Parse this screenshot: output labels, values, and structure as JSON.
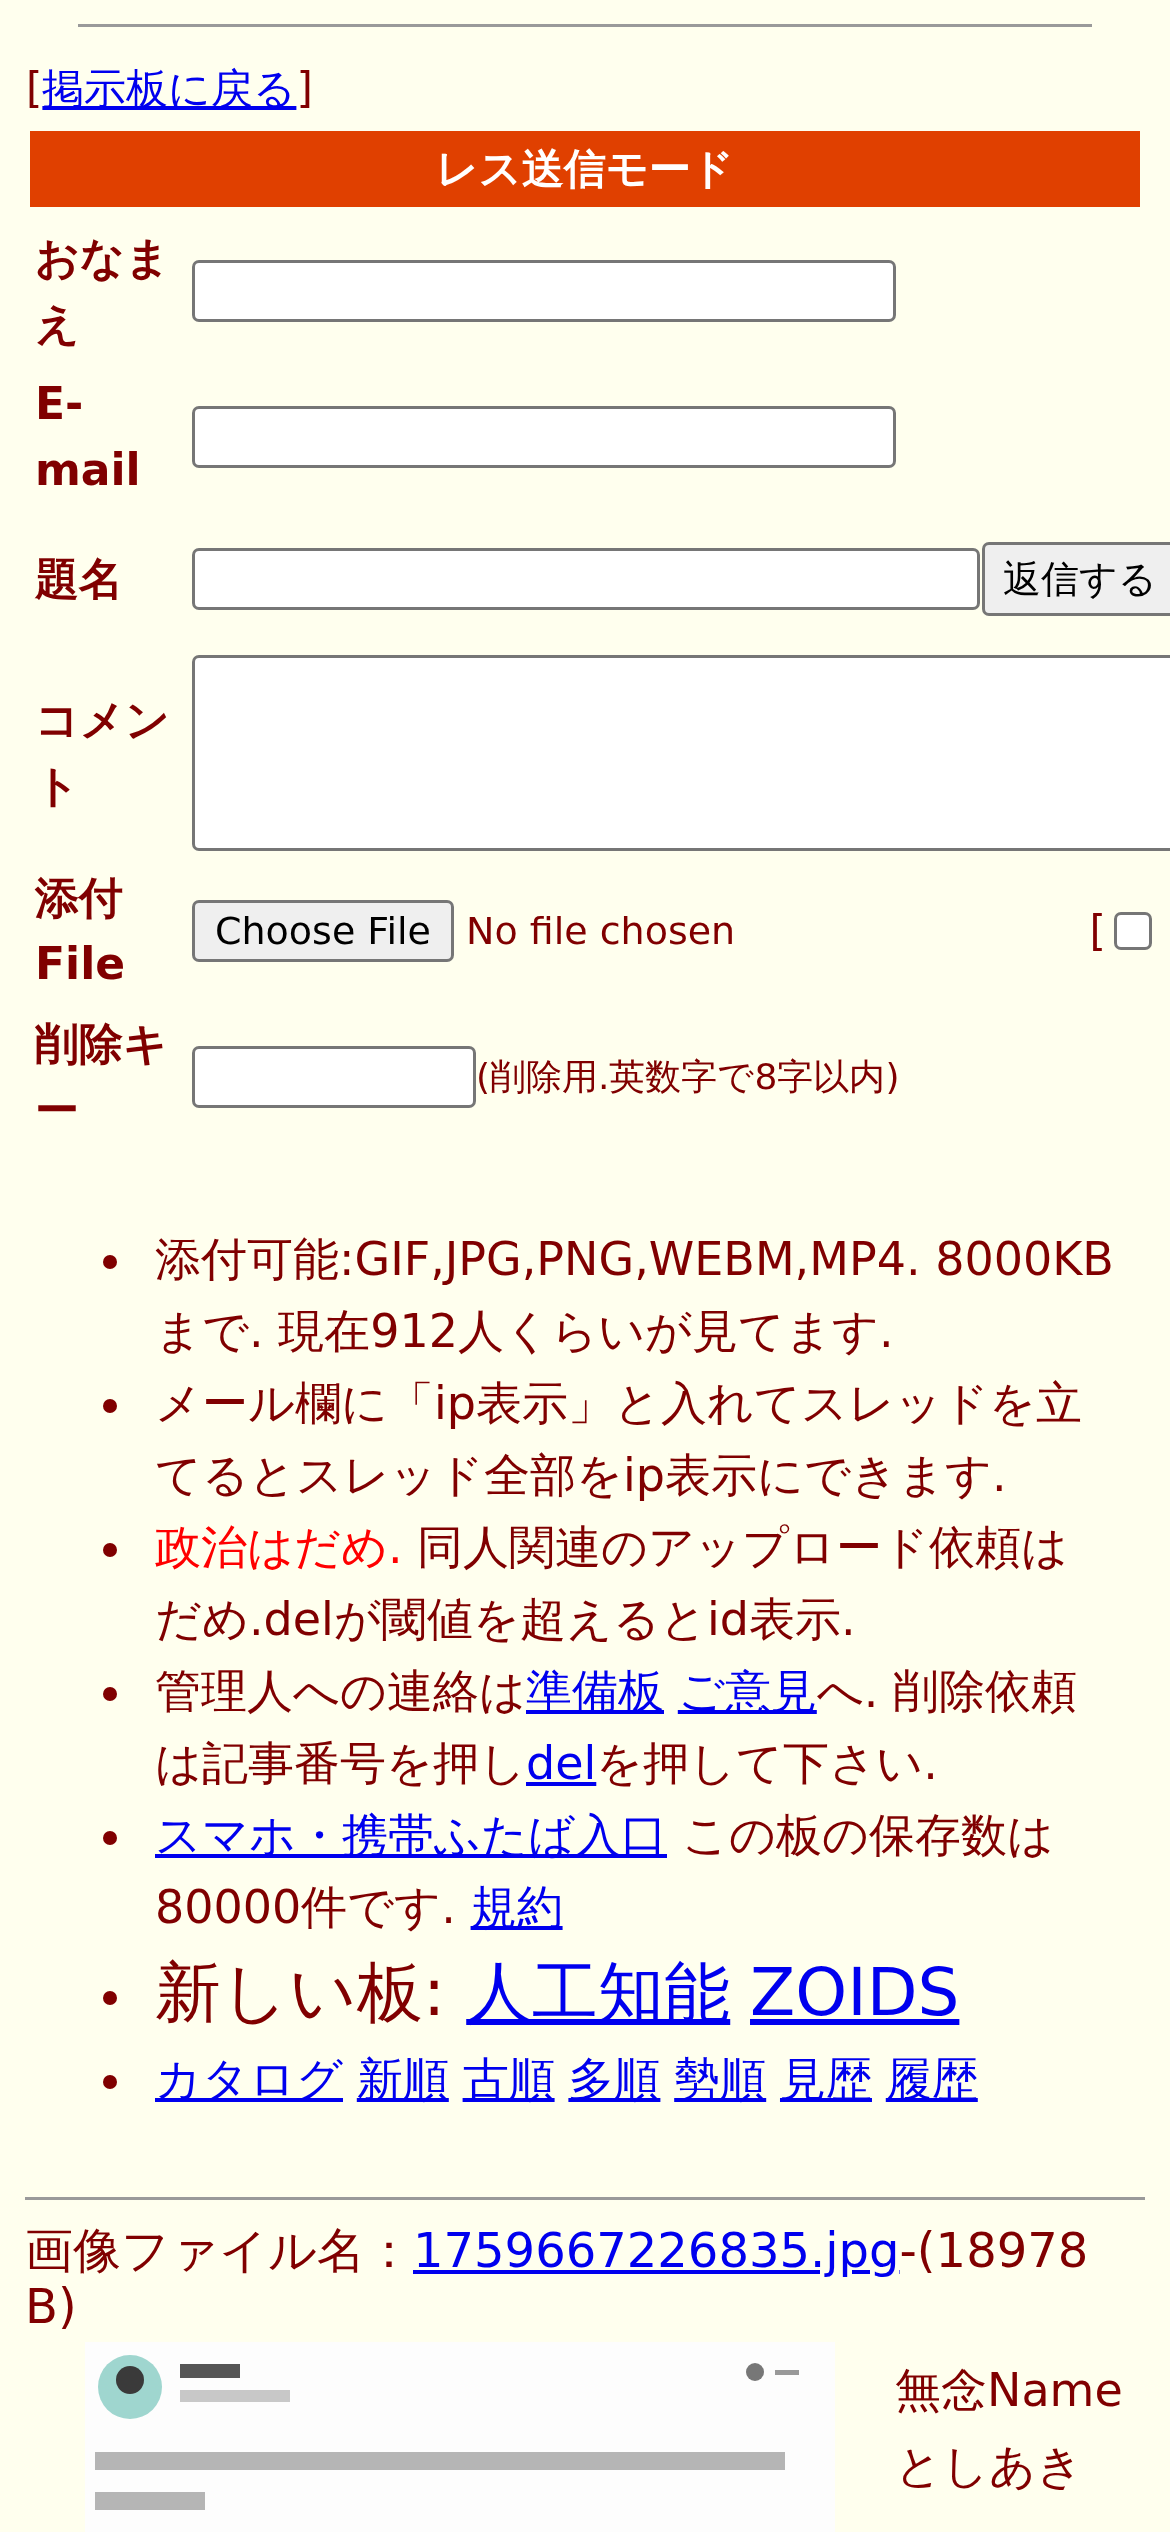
{
  "back_link": {
    "open": "[",
    "label": "掲示板に戻る",
    "close": "]"
  },
  "form": {
    "title": "レス送信モード",
    "rows": [
      {
        "kind": "text",
        "label": "おなまえ"
      },
      {
        "kind": "text",
        "label": "E-mail"
      },
      {
        "kind": "subject",
        "label": "題名",
        "button": "返信する"
      },
      {
        "kind": "textarea",
        "label": "コメント"
      },
      {
        "kind": "file",
        "label": "添付File",
        "button": "Choose File",
        "status": "No file chosen",
        "option_open": "[",
        "checked": false
      },
      {
        "kind": "key",
        "label": "削除キー",
        "note": "(削除用.英数字で8字以内)"
      }
    ]
  },
  "notices": [
    {
      "kind": "normal",
      "segments": [
        {
          "kind": "text",
          "text": "添付可能:GIF,JPG,PNG,WEBM,MP4. 8000KBまで. 現在912人くらいが見てます."
        }
      ]
    },
    {
      "kind": "normal",
      "segments": [
        {
          "kind": "text",
          "text": "メール欄に「ip表示」と入れてスレッドを立てるとスレッド全部をip表示にできます."
        }
      ]
    },
    {
      "kind": "normal",
      "segments": [
        {
          "kind": "warning",
          "text": "政治はだめ."
        },
        {
          "kind": "text",
          "text": " 同人関連のアップロード依頼はだめ.delが閾値を超えるとid表示."
        }
      ]
    },
    {
      "kind": "normal",
      "segments": [
        {
          "kind": "text",
          "text": "管理人への連絡は"
        },
        {
          "kind": "link",
          "text": "準備板"
        },
        {
          "kind": "link",
          "text": "ご意見"
        },
        {
          "kind": "text",
          "text": "へ. 削除依頼は記事番号を押し"
        },
        {
          "kind": "link",
          "text": "del"
        },
        {
          "kind": "text",
          "text": "を押して下さい."
        }
      ]
    },
    {
      "kind": "normal",
      "segments": [
        {
          "kind": "link",
          "text": "スマホ・携帯ふたば入口"
        },
        {
          "kind": "text",
          "text": " この板の保存数は80000件です. "
        },
        {
          "kind": "link",
          "text": "規約"
        }
      ]
    },
    {
      "kind": "large",
      "segments": [
        {
          "kind": "text",
          "text": "新しい板: "
        },
        {
          "kind": "link",
          "text": "人工知能"
        },
        {
          "kind": "link",
          "text": "ZOIDS"
        }
      ]
    },
    {
      "kind": "normal",
      "segments": [
        {
          "kind": "link",
          "text": "カタログ"
        },
        {
          "kind": "link",
          "text": "新順"
        },
        {
          "kind": "link",
          "text": "古順"
        },
        {
          "kind": "link",
          "text": "多順"
        },
        {
          "kind": "link",
          "text": "勢順"
        },
        {
          "kind": "link",
          "text": "見歴"
        },
        {
          "kind": "link",
          "text": "履歴"
        }
      ]
    }
  ],
  "post": {
    "file_label": "画像ファイル名：",
    "file_link": "1759667226835.jpg",
    "file_size": "-(18978B)",
    "subject": "無念Name",
    "name": "としあき"
  }
}
